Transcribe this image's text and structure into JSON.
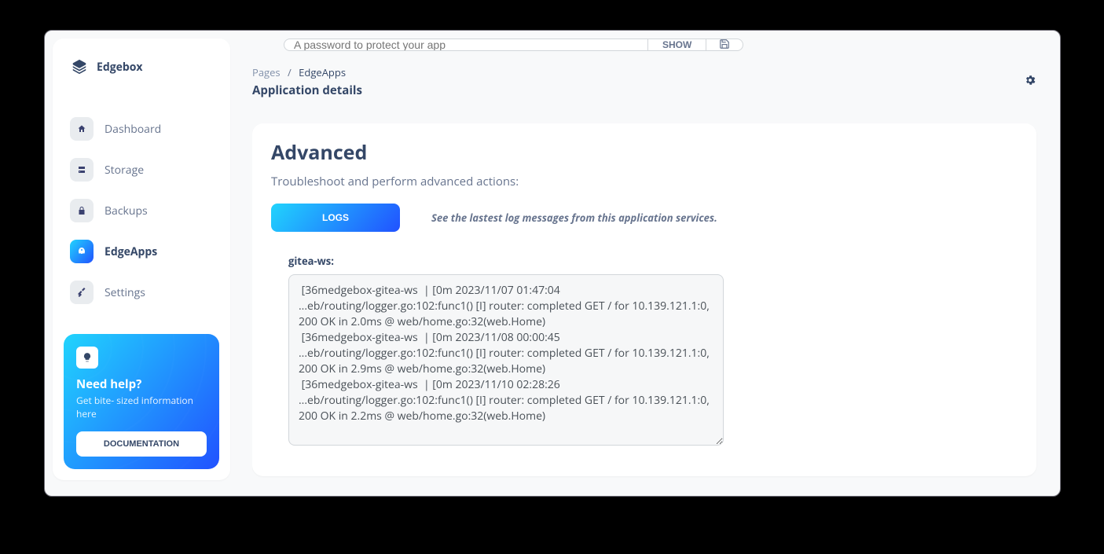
{
  "brand": {
    "name": "Edgebox"
  },
  "sidebar": {
    "items": [
      {
        "label": "Dashboard",
        "active": false
      },
      {
        "label": "Storage",
        "active": false
      },
      {
        "label": "Backups",
        "active": false
      },
      {
        "label": "EdgeApps",
        "active": true
      },
      {
        "label": "Settings",
        "active": false
      }
    ]
  },
  "help": {
    "title": "Need help?",
    "subtitle": "Get bite- sized information here",
    "button": "DOCUMENTATION"
  },
  "breadcrumb": {
    "root": "Pages",
    "current": "EdgeApps",
    "title": "Application details"
  },
  "topbar": {
    "password_placeholder": "A password to protect your app",
    "show_label": "SHOW"
  },
  "advanced": {
    "title": "Advanced",
    "subtitle": "Troubleshoot and perform advanced actions:",
    "logs_button": "LOGS",
    "logs_description": "See the lastest log messages from this application services.",
    "log_name": "gitea-ws:",
    "log_content": " [36medgebox-gitea-ws  | [0m 2023/11/07 01:47:04 ...eb/routing/logger.go:102:func1() [I] router: completed GET / for 10.139.121.1:0, 200 OK in 2.0ms @ web/home.go:32(web.Home)\n [36medgebox-gitea-ws  | [0m 2023/11/08 00:00:45 ...eb/routing/logger.go:102:func1() [I] router: completed GET / for 10.139.121.1:0, 200 OK in 2.9ms @ web/home.go:32(web.Home)\n [36medgebox-gitea-ws  | [0m 2023/11/10 02:28:26 ...eb/routing/logger.go:102:func1() [I] router: completed GET / for 10.139.121.1:0, 200 OK in 2.2ms @ web/home.go:32(web.Home)"
  }
}
